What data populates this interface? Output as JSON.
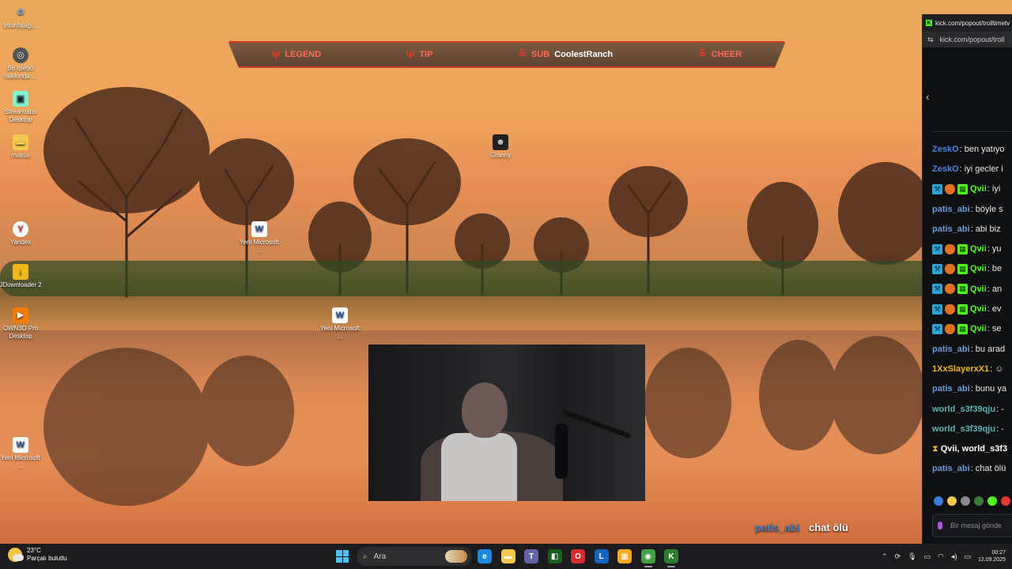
{
  "desktop": {
    "icons": [
      {
        "label": "İnfohfişağı...",
        "symbol": "♻",
        "bg": "#ffffff00"
      },
      {
        "label": "Bu işletici hakkında ...",
        "symbol": "◎",
        "bg": "#555555"
      },
      {
        "label": "Streamlabs Desktop",
        "symbol": "▣",
        "bg": "#80f5d2"
      },
      {
        "label": "masüs",
        "symbol": "▬",
        "bg": "#f2c94c"
      },
      {
        "label": "Yandex",
        "symbol": "Y",
        "bg": "#ffffff"
      },
      {
        "label": "JDownloader 2",
        "symbol": "↓",
        "bg": "#f2b81b"
      },
      {
        "label": "OWN3D Pro Desktop",
        "symbol": "▶",
        "bg": "#f57c00"
      },
      {
        "label": "Yeni Microsoft ...",
        "symbol": "W",
        "bg": "#ffffff"
      },
      {
        "label": "Granny",
        "symbol": "☻",
        "bg": "#222222"
      },
      {
        "label": "Yeni Microsoft ...",
        "symbol": "W",
        "bg": "#ffffff"
      },
      {
        "label": "Yeni Microsoft ...",
        "symbol": "W",
        "bg": "#ffffff"
      }
    ]
  },
  "banner": {
    "items": [
      {
        "label": "LEGEND",
        "name": ""
      },
      {
        "label": "TIP",
        "name": ""
      },
      {
        "label": "SUB",
        "name": "CoolestRanch"
      },
      {
        "label": "CHEER",
        "name": ""
      }
    ]
  },
  "stream_chat_overlay": {
    "user": "patis_abi",
    "message": "chat ölü"
  },
  "browser": {
    "title": "kick.com/popout/trolltimetv",
    "url": "kick.com/popout/troll",
    "chat": [
      {
        "user": "ZeskO",
        "color": "#4a83d9",
        "badges": [],
        "text": ": ben yatıyo"
      },
      {
        "user": "ZeskO",
        "color": "#4a83d9",
        "badges": [],
        "text": ": iyi gecler i"
      },
      {
        "user": "Qvii",
        "color": "#53fc18",
        "badges": [
          "mod",
          "shield",
          "gift"
        ],
        "text": ": iyi"
      },
      {
        "user": "patis_abi",
        "color": "#6f9bd6",
        "badges": [],
        "text": ": böyle s"
      },
      {
        "user": "patis_abi",
        "color": "#6f9bd6",
        "badges": [],
        "text": ": abi biz"
      },
      {
        "user": "Qvii",
        "color": "#53fc18",
        "badges": [
          "mod",
          "shield",
          "gift"
        ],
        "text": ": yu"
      },
      {
        "user": "Qvii",
        "color": "#53fc18",
        "badges": [
          "mod",
          "shield",
          "gift"
        ],
        "text": ": be"
      },
      {
        "user": "Qvii",
        "color": "#53fc18",
        "badges": [
          "mod",
          "shield",
          "gift"
        ],
        "text": ": an"
      },
      {
        "user": "Qvii",
        "color": "#53fc18",
        "badges": [
          "mod",
          "shield",
          "gift"
        ],
        "text": ": ev"
      },
      {
        "user": "Qvii",
        "color": "#53fc18",
        "badges": [
          "mod",
          "shield",
          "gift"
        ],
        "text": ": se"
      },
      {
        "user": "patis_abi",
        "color": "#6f9bd6",
        "badges": [],
        "text": ": bu arad"
      },
      {
        "user": "1XxSlayerxX1",
        "color": "#f2b81b",
        "badges": [],
        "text": ": ☺"
      },
      {
        "user": "patis_abi",
        "color": "#6f9bd6",
        "badges": [],
        "text": ": bunu ya"
      },
      {
        "user": "world_s3f39qju",
        "color": "#5fb3b3",
        "badges": [],
        "text": ": -"
      },
      {
        "user": "world_s3f39qju",
        "color": "#5fb3b3",
        "badges": [],
        "text": ": -"
      },
      {
        "user": "Qvii, world_s3f3",
        "color": "#ffffff",
        "badges": [
          "hourglass"
        ],
        "text": ""
      },
      {
        "user": "patis_abi",
        "color": "#6f9bd6",
        "badges": [],
        "text": ": chat ölü"
      }
    ],
    "input_placeholder": "Bir mesaj gönde",
    "bottom_icon": "∞"
  },
  "taskbar": {
    "weather_temp": "23°C",
    "weather_desc": "Parçalı bulutlu",
    "weather_badge": "1",
    "search_placeholder": "Ara",
    "apps": [
      {
        "name": "edge",
        "symbol": "e",
        "bg": "#1e88e5"
      },
      {
        "name": "file-explorer",
        "symbol": "▬",
        "bg": "#f2c94c"
      },
      {
        "name": "teams",
        "symbol": "T",
        "bg": "#6264a7"
      },
      {
        "name": "app-green",
        "symbol": "◧",
        "bg": "#1b5e20"
      },
      {
        "name": "opera",
        "symbol": "O",
        "bg": "#d32f2f"
      },
      {
        "name": "app-blue",
        "symbol": "L",
        "bg": "#1565c0"
      },
      {
        "name": "folder-app",
        "symbol": "▦",
        "bg": "#f9a825"
      },
      {
        "name": "chrome",
        "symbol": "◉",
        "bg": "#43a047"
      },
      {
        "name": "kick",
        "symbol": "K",
        "bg": "#2e7d32"
      }
    ],
    "time": "00:27",
    "date": "12.09.2025"
  }
}
